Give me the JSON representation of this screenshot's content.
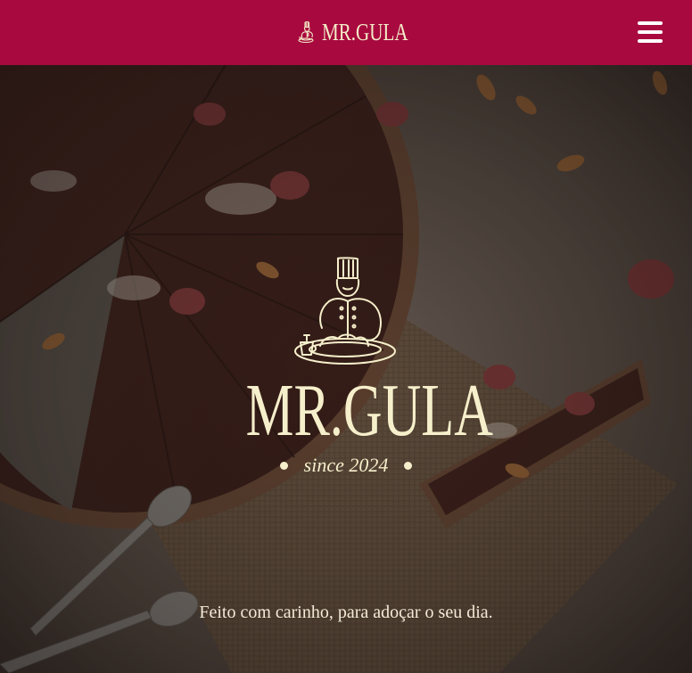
{
  "header": {
    "brand_name": "MR.GULA",
    "brand_icon": "chef-icon",
    "menu_icon": "hamburger-menu-icon",
    "background_color": "#a8093f"
  },
  "hero": {
    "logo_icon": "chef-plating-icon",
    "title": "MR.GULA",
    "since": "since 2024",
    "tagline": "Feito com carinho, para adoçar o seu dia.",
    "text_color": "#f6efcb"
  }
}
